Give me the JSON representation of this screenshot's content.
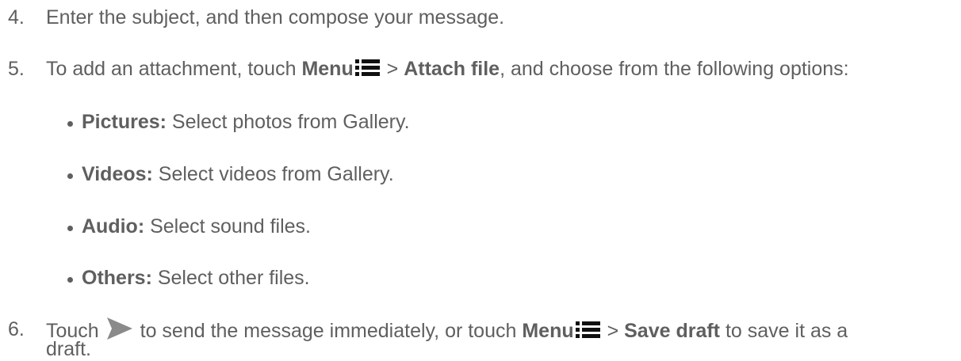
{
  "steps": [
    {
      "number": "4.",
      "text": "Enter the subject, and then compose your message."
    },
    {
      "number": "5.",
      "pre": "To add an attachment, touch ",
      "menu_label": "Menu",
      "sep": " > ",
      "attach_label": "Attach file",
      "post": ", and choose from the following options:",
      "options": [
        {
          "label": "Pictures:",
          "text": " Select photos from Gallery."
        },
        {
          "label": "Videos:",
          "text": " Select videos from Gallery."
        },
        {
          "label": "Audio:",
          "text": " Select sound files."
        },
        {
          "label": "Others:",
          "text": " Select other files."
        }
      ]
    },
    {
      "number": "6.",
      "pre": "Touch ",
      "mid": " to send the message immediately, or touch ",
      "menu_label": "Menu",
      "sep": " > ",
      "save_label": "Save draft",
      "post": " to save it as a",
      "cont": "draft."
    }
  ],
  "icons": {
    "menu": "menu-icon",
    "send": "send-icon"
  },
  "colors": {
    "text": "#5f5f5f",
    "icon": "#111111",
    "send_icon": "#8a8a8a"
  }
}
